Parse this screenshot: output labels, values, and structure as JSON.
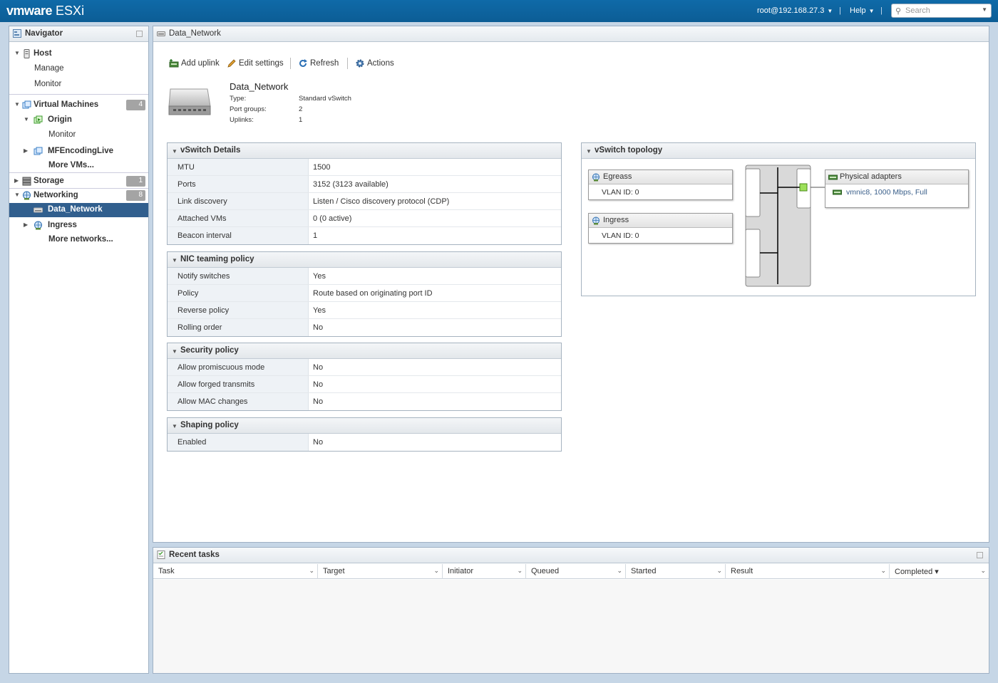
{
  "topbar": {
    "brand": "vmware",
    "product": "ESXi",
    "user": "root@192.168.27.3",
    "help": "Help",
    "search_placeholder": "Search"
  },
  "navigator": {
    "title": "Navigator",
    "host": "Host",
    "manage": "Manage",
    "monitor": "Monitor",
    "vms": "Virtual Machines",
    "vms_count": "4",
    "origin": "Origin",
    "origin_monitor": "Monitor",
    "mfencoding": "MFEncodingLive",
    "more_vms": "More VMs...",
    "storage": "Storage",
    "storage_count": "1",
    "networking": "Networking",
    "networking_count": "8",
    "data_network": "Data_Network",
    "ingress": "Ingress",
    "more_networks": "More networks..."
  },
  "main": {
    "title": "Data_Network",
    "toolbar": {
      "add_uplink": "Add uplink",
      "edit_settings": "Edit settings",
      "refresh": "Refresh",
      "actions": "Actions"
    },
    "summary": {
      "name": "Data_Network",
      "type_label": "Type:",
      "type_value": "Standard vSwitch",
      "portgroups_label": "Port groups:",
      "portgroups_value": "2",
      "uplinks_label": "Uplinks:",
      "uplinks_value": "1"
    },
    "vswitch_details": {
      "title": "vSwitch Details",
      "rows": [
        {
          "k": "MTU",
          "v": "1500"
        },
        {
          "k": "Ports",
          "v": "3152 (3123 available)"
        },
        {
          "k": "Link discovery",
          "v": "Listen / Cisco discovery protocol (CDP)"
        },
        {
          "k": "Attached VMs",
          "v": "0 (0 active)"
        },
        {
          "k": "Beacon interval",
          "v": "1"
        }
      ]
    },
    "nic_teaming": {
      "title": "NIC teaming policy",
      "rows": [
        {
          "k": "Notify switches",
          "v": "Yes"
        },
        {
          "k": "Policy",
          "v": "Route based on originating port ID"
        },
        {
          "k": "Reverse policy",
          "v": "Yes"
        },
        {
          "k": "Rolling order",
          "v": "No"
        }
      ]
    },
    "security": {
      "title": "Security policy",
      "rows": [
        {
          "k": "Allow promiscuous mode",
          "v": "No"
        },
        {
          "k": "Allow forged transmits",
          "v": "No"
        },
        {
          "k": "Allow MAC changes",
          "v": "No"
        }
      ]
    },
    "shaping": {
      "title": "Shaping policy",
      "rows": [
        {
          "k": "Enabled",
          "v": "No"
        }
      ]
    },
    "topology": {
      "title": "vSwitch topology",
      "egress": {
        "name": "Egreass",
        "vlan": "VLAN ID: 0"
      },
      "ingress": {
        "name": "Ingress",
        "vlan": "VLAN ID: 0"
      },
      "physical": {
        "title": "Physical adapters",
        "nic": "vmnic8, 1000 Mbps, Full"
      }
    }
  },
  "tasks": {
    "title": "Recent tasks",
    "columns": [
      "Task",
      "Target",
      "Initiator",
      "Queued",
      "Started",
      "Result",
      "Completed ▾"
    ]
  },
  "colors": {
    "topbar": "#0f6aa8",
    "selected_nav": "#315f8e",
    "badge": "#a4a4a4",
    "link": "#3a5f8a"
  }
}
